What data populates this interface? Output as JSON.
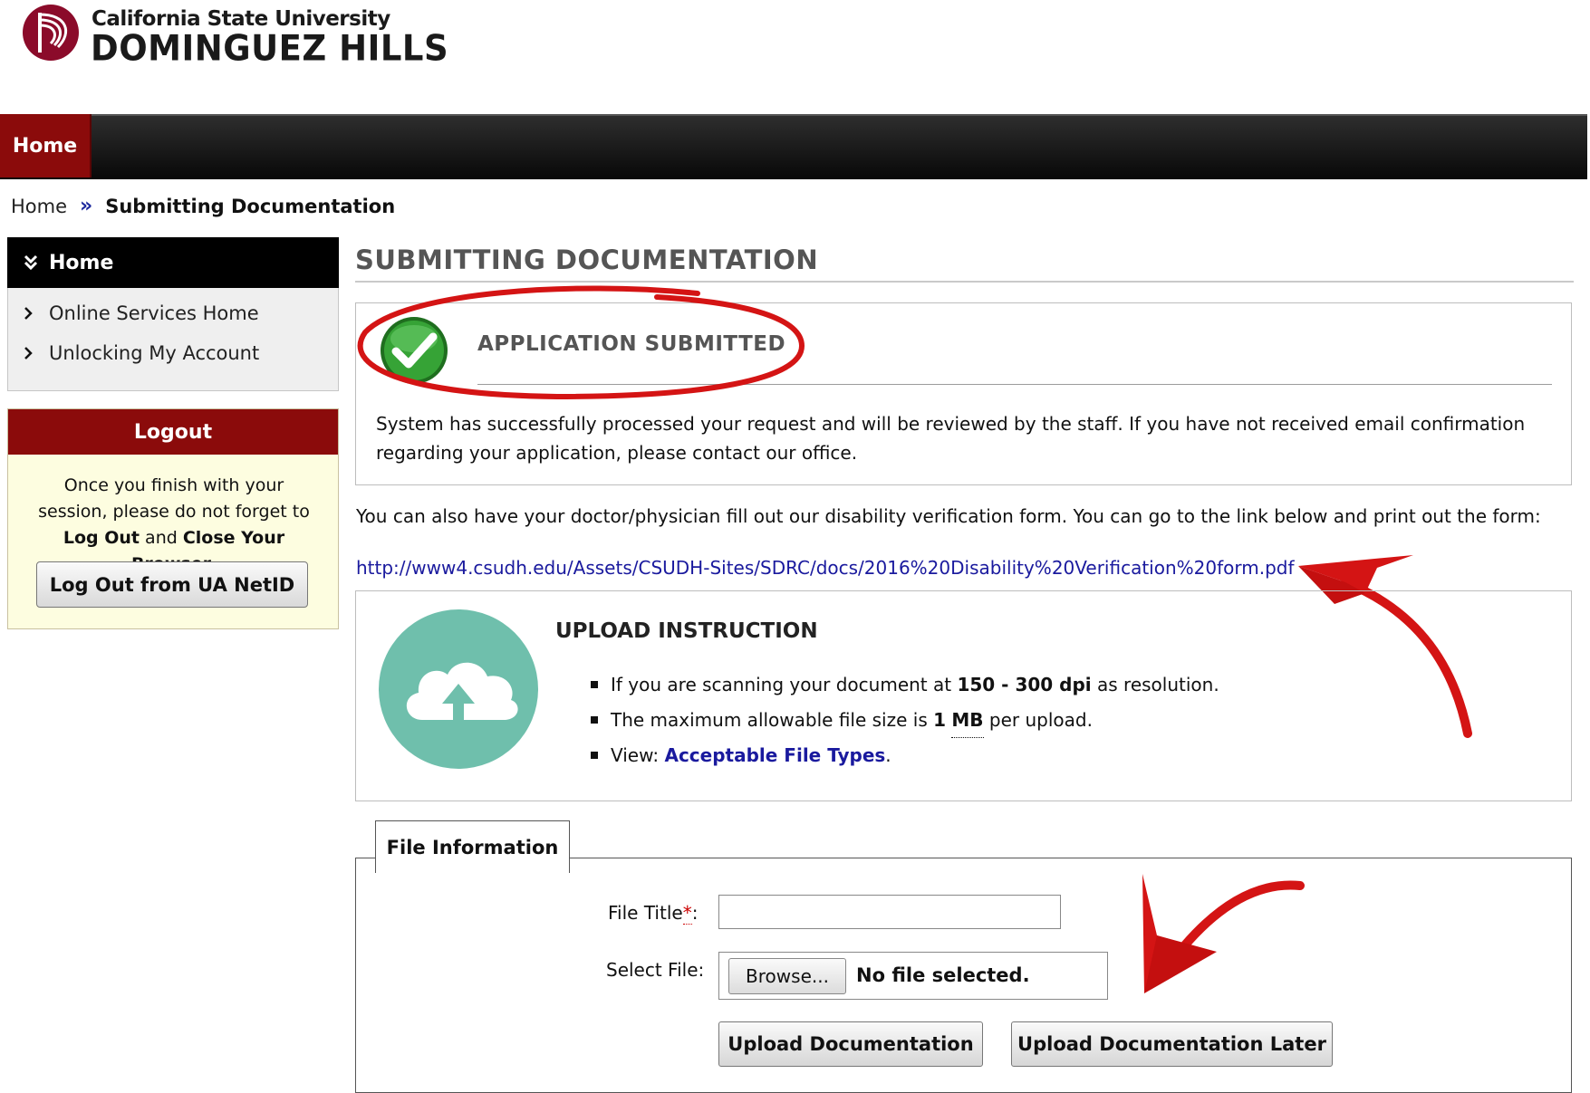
{
  "logo": {
    "line1": "California State University",
    "line2": "DOMINGUEZ HILLS"
  },
  "nav": {
    "home_label": "Home"
  },
  "breadcrumb": {
    "home": "Home",
    "separator": "»",
    "current": "Submitting Documentation"
  },
  "sidebar": {
    "heading": "Home",
    "items": [
      {
        "label": "Online Services Home"
      },
      {
        "label": "Unlocking My Account"
      }
    ]
  },
  "logout": {
    "heading": "Logout",
    "text_1": "Once you finish with your session, please do not forget to",
    "text_log_out": "Log Out",
    "text_and": "and",
    "text_close": "Close Your Browser",
    "text_end": ".",
    "button_label": "Log Out from UA NetID"
  },
  "main": {
    "title": "SUBMITTING DOCUMENTATION",
    "submitted": {
      "heading": "APPLICATION SUBMITTED",
      "message": "System has successfully processed your request and will be reviewed by the staff. If you have not received email confirmation regarding your application, please contact our office."
    },
    "verification_text": "You can also have your doctor/physician fill out our disability verification form. You can go to the link below and print out the form:",
    "verification_link": "http://www4.csudh.edu/Assets/CSUDH-Sites/SDRC/docs/2016%20Disability%20Verification%20form.pdf",
    "upload": {
      "heading": "UPLOAD INSTRUCTION",
      "item1_pre": "If you are scanning your document at",
      "item1_bold": "150 - 300 dpi",
      "item1_post": "as resolution.",
      "item2_pre": "The maximum allowable file size is",
      "item2_num": "1",
      "item2_unit": "MB",
      "item2_post": "per upload.",
      "item3_pre": "View:",
      "item3_link": "Acceptable File Types",
      "item3_post": "."
    },
    "file_info": {
      "tab_label": "File Information",
      "title_label": "File Title",
      "required_mark": "*",
      "title_colon": ":",
      "title_value": "",
      "select_label": "Select File:",
      "browse_label": "Browse...",
      "no_file": "No file selected.",
      "upload_button": "Upload Documentation",
      "upload_later_button": "Upload Documentation Later"
    }
  },
  "colors": {
    "brand_red": "#8b0b0b",
    "annotation_red": "#d41414",
    "link_blue": "#1a1a9e",
    "cloud_teal": "#6fbfac",
    "check_green": "#2f9a2f"
  },
  "icons": [
    "csudh-logo-icon",
    "double-chevron-down-icon",
    "chevron-right-icon",
    "green-check-icon",
    "cloud-upload-icon",
    "red-annotation-arrow-icon"
  ]
}
